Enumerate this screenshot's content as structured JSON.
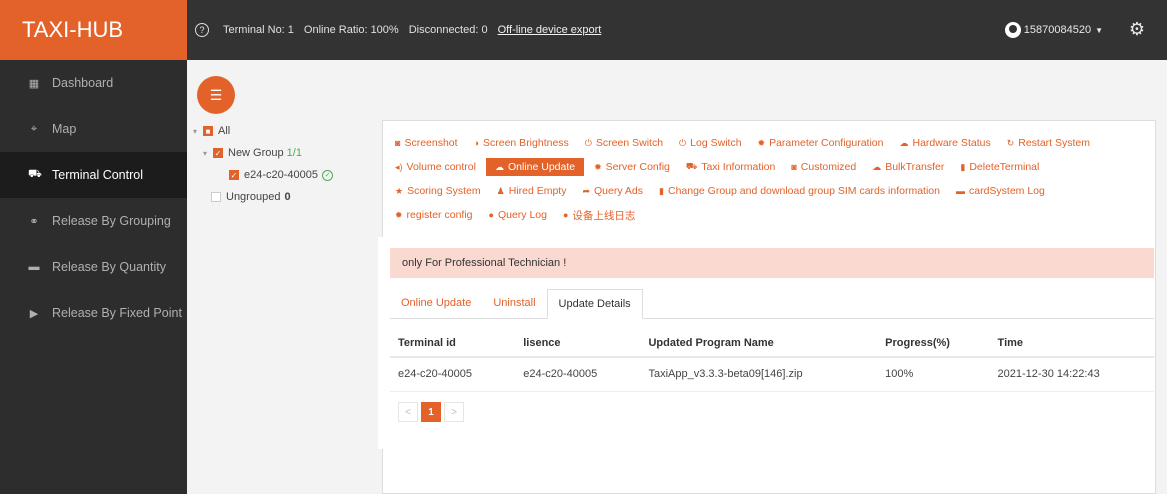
{
  "header": {
    "brand": "TAXI-HUB",
    "help_glyph": "?",
    "terminal_no": "Terminal No: 1",
    "online_ratio": "Online Ratio: 100%",
    "disconnected": "Disconnected: 0",
    "export_link": "Off-line device export",
    "username": "15870084520"
  },
  "sidebar": {
    "items": [
      {
        "label": "Dashboard",
        "icon": "dashboard-icon"
      },
      {
        "label": "Map",
        "icon": "map-icon"
      },
      {
        "label": "Terminal Control",
        "icon": "car-icon"
      },
      {
        "label": "Release By Grouping",
        "icon": "group-icon"
      },
      {
        "label": "Release By Quantity",
        "icon": "quantity-icon"
      },
      {
        "label": "Release By Fixed Point",
        "icon": "play-icon"
      }
    ]
  },
  "tree": {
    "all": "All",
    "group_name": "New Group",
    "group_count": "1/1",
    "terminal": "e24-c20-40005",
    "ungrouped": "Ungrouped",
    "ungrouped_count": "0"
  },
  "toolbar": {
    "row1": [
      "Screenshot",
      "Screen Brightness",
      "Screen Switch",
      "Log Switch",
      "Parameter Configuration",
      "Hardware Status",
      "Restart System"
    ],
    "row2": [
      "Volume control",
      "Online Update",
      "Server Config",
      "Taxi Information",
      "Customized",
      "BulkTransfer",
      "DeleteTerminal"
    ],
    "row3": [
      "Scoring System",
      "Hired Empty",
      "Query Ads",
      "Change Group and download group SIM cards information",
      "cardSystem Log"
    ],
    "row4": [
      "register config",
      "Query Log",
      "设备上线日志"
    ]
  },
  "notice": "only For Professional Technician !",
  "tabs": [
    "Online Update",
    "Uninstall",
    "Update Details"
  ],
  "table": {
    "headers": [
      "Terminal id",
      "lisence",
      "Updated Program Name",
      "Progress(%)",
      "Time"
    ],
    "rows": [
      [
        "e24-c20-40005",
        "e24-c20-40005",
        "TaxiApp_v3.3.3-beta09[146].zip",
        "100%",
        "2021-12-30 14:22:43"
      ]
    ]
  },
  "pager": {
    "prev": "<",
    "page": "1",
    "next": ">"
  },
  "colors": {
    "accent": "#e2622a",
    "topbar": "#333333",
    "sidebar": "#2d2d2d",
    "notice": "#f9d9d0"
  }
}
